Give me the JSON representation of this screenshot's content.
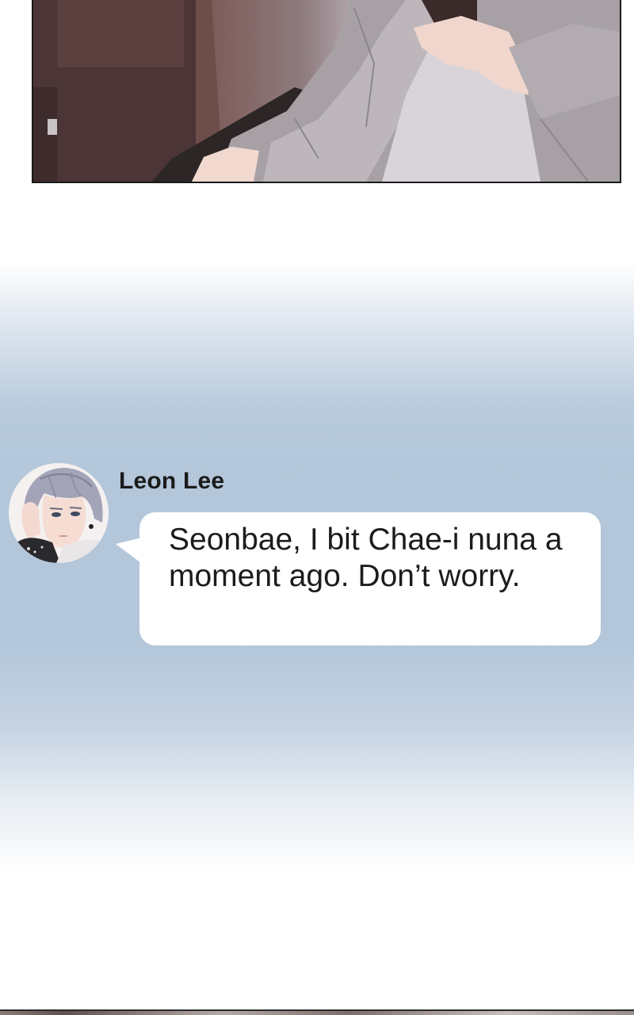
{
  "chat": {
    "sender_name": "Leon Lee",
    "message": "Seonbae, I bit Chae-i nuna a moment ago. Don’t worry."
  },
  "colors": {
    "chat_band": "#b3c6da",
    "bubble": "#ffffff",
    "text": "#1c1c1c"
  }
}
